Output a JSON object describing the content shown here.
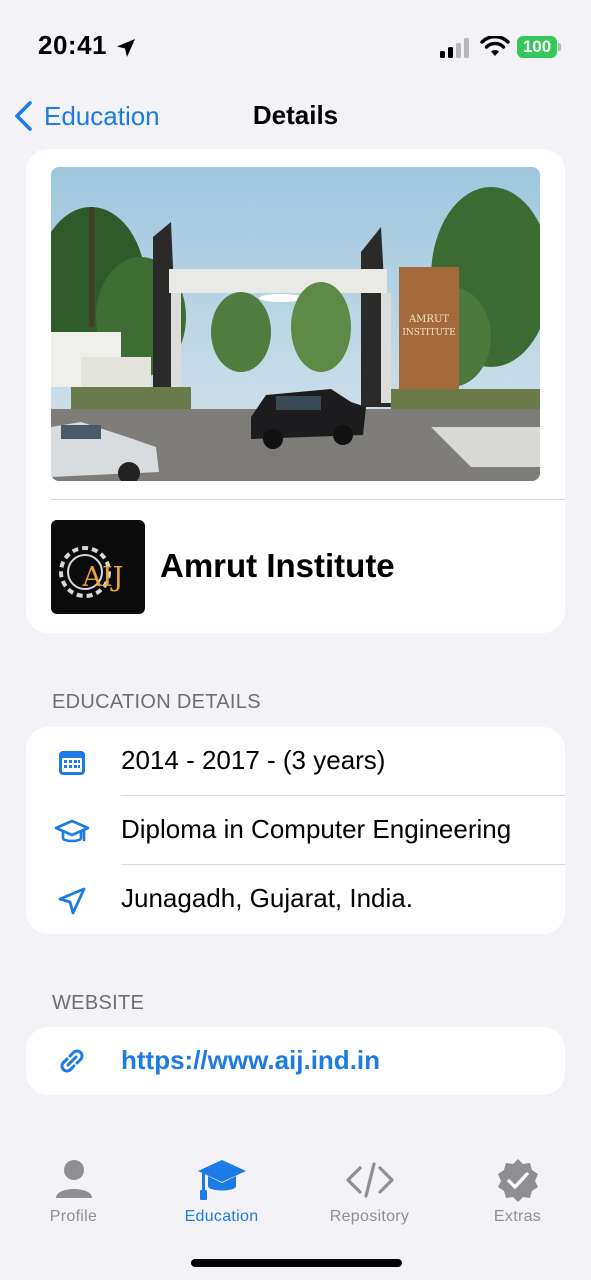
{
  "status_bar": {
    "time": "20:41",
    "battery": "100",
    "battery_color": "#34c759",
    "icons": [
      "location-arrow-icon",
      "signal-icon",
      "wifi-icon",
      "battery-icon"
    ]
  },
  "nav": {
    "back_label": "Education",
    "title": "Details"
  },
  "hero": {
    "image_description": "Amrut Institute entrance gate",
    "logo_text": "AIJ",
    "institute_name": "Amrut Institute"
  },
  "education_section": {
    "header": "EDUCATION DETAILS",
    "rows": [
      {
        "icon": "calendar-icon",
        "text": "2014 - 2017 - (3 years)"
      },
      {
        "icon": "graduation-cap-icon",
        "text": "Diploma in Computer Engineering"
      },
      {
        "icon": "location-arrow-icon",
        "text": "Junagadh, Gujarat, India."
      }
    ]
  },
  "website_section": {
    "header": "WEBSITE",
    "url": "https://www.aij.ind.in",
    "icon": "link-icon"
  },
  "tabs": [
    {
      "label": "Profile",
      "icon": "person-icon",
      "active": false
    },
    {
      "label": "Education",
      "icon": "graduation-cap-icon",
      "active": true
    },
    {
      "label": "Repository",
      "icon": "code-icon",
      "active": false
    },
    {
      "label": "Extras",
      "icon": "checkmark-seal-icon",
      "active": false
    }
  ],
  "colors": {
    "accent": "#1c7be6",
    "background": "#f2f2f7",
    "inactive_tab": "#8e8e93"
  }
}
